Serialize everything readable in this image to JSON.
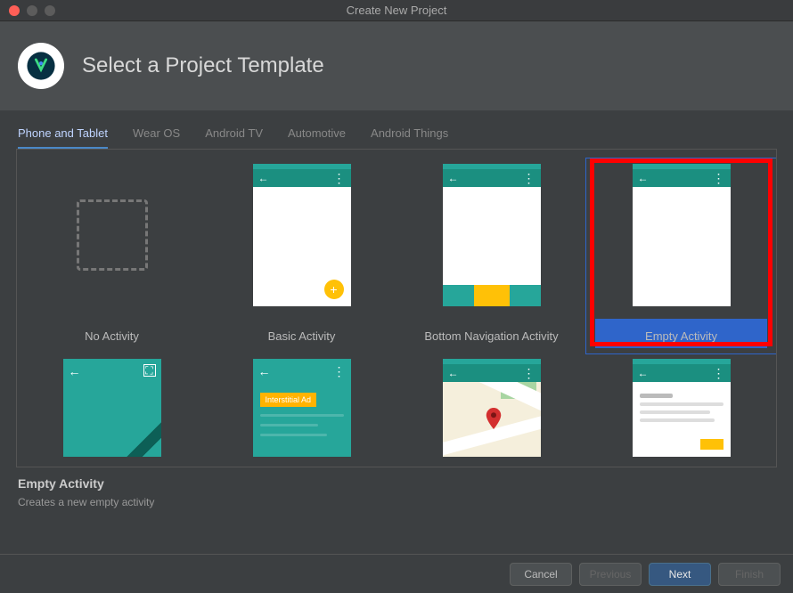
{
  "window": {
    "title": "Create New Project"
  },
  "header": {
    "title": "Select a Project Template"
  },
  "tabs": [
    {
      "label": "Phone and Tablet",
      "active": true
    },
    {
      "label": "Wear OS",
      "active": false
    },
    {
      "label": "Android TV",
      "active": false
    },
    {
      "label": "Automotive",
      "active": false
    },
    {
      "label": "Android Things",
      "active": false
    }
  ],
  "templates": {
    "row1": [
      {
        "id": "no-activity",
        "label": "No Activity"
      },
      {
        "id": "basic-activity",
        "label": "Basic Activity"
      },
      {
        "id": "bottom-nav",
        "label": "Bottom Navigation Activity"
      },
      {
        "id": "empty-activity",
        "label": "Empty Activity",
        "selected": true,
        "highlighted": true
      }
    ],
    "row2_partial": [
      {
        "id": "fullscreen-activity"
      },
      {
        "id": "admob-activity",
        "ad_text": "Interstitial Ad"
      },
      {
        "id": "maps-activity"
      },
      {
        "id": "scrolling-activity"
      }
    ]
  },
  "detail": {
    "title": "Empty Activity",
    "description": "Creates a new empty activity"
  },
  "footer": {
    "cancel": "Cancel",
    "previous": "Previous",
    "next": "Next",
    "finish": "Finish"
  }
}
